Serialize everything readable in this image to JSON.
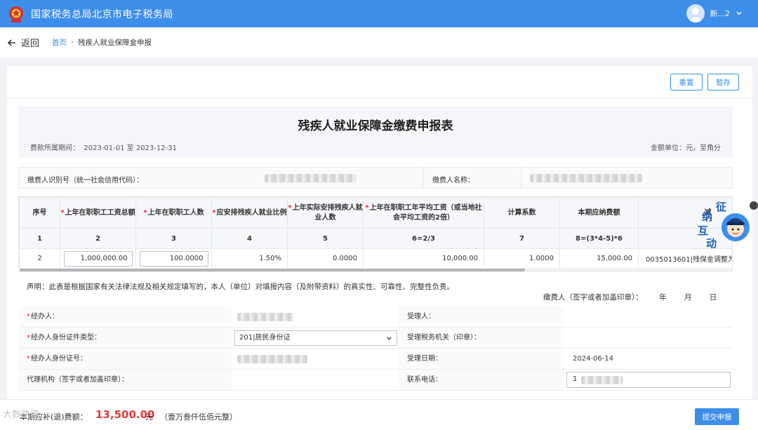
{
  "header": {
    "site_title": "国家税务总局北京市电子税务局",
    "user_name": "新...2"
  },
  "nav": {
    "back_label": "返回",
    "breadcrumb_home": "首页",
    "breadcrumb_sep": "›",
    "breadcrumb_current": "残疾人就业保障金申报"
  },
  "toolbar": {
    "reset_label": "重置",
    "save_label": "暂存"
  },
  "form": {
    "title": "残疾人就业保障金缴费申报表",
    "period_label": "费款所属期间：",
    "period_value": "2023-01-01 至 2023-12-31",
    "unit_label": "金额单位：元，至角分",
    "payer_id_label": "缴费人识别号（统一社会信用代码）：",
    "payer_name_label": "缴费人名称："
  },
  "table": {
    "required_mark": "*",
    "columns": [
      {
        "label": "序号",
        "required": false
      },
      {
        "label": "上年在职职工工资总额",
        "required": true
      },
      {
        "label": "上年在职职工人数",
        "required": true
      },
      {
        "label": "应安排残疾人就业比例",
        "required": true
      },
      {
        "label": "上年实际安排残疾人就业人数",
        "required": true
      },
      {
        "label": "上年在职职工年平均工资（或当地社会平均工资的2倍）",
        "required": true
      },
      {
        "label": "计算系数",
        "required": false
      },
      {
        "label": "本期应纳费额",
        "required": false
      },
      {
        "label": "减",
        "required": false
      }
    ],
    "index_row": [
      "1",
      "2",
      "3",
      "4",
      "5",
      "6=2/3",
      "7",
      "8=(3*4-5)*6",
      ""
    ],
    "data_row": [
      "2",
      "1,000,000.00",
      "100.0000",
      "1.50%",
      "0.0000",
      "10,000.00",
      "1.0000",
      "15,000.00",
      "0035013601|残保金调整为"
    ]
  },
  "declaration": {
    "text": "声明：此表是根据国家有关法律法规及相关规定填写的，本人（单位）对填报内容（及附带资料）的真实性、可靠性、完整性负责。",
    "sign_label": "缴费人（签字或者加盖印章）：",
    "year": "年",
    "month": "月",
    "day": "日"
  },
  "info": {
    "required_mark": "*",
    "agent_label": "经办人：",
    "agent_id_type_label": "经办人身份证件类型：",
    "agent_id_type_value": "201|居民身份证",
    "agent_id_label": "经办人身份证号：",
    "agency_label": "代理机构（签字或者加盖印章）：",
    "receiver_label": "受理人：",
    "tax_office_label": "受理税务机关（印章）：",
    "accept_date_label": "受理日期：",
    "accept_date_value": "2024-06-14",
    "phone_label": "联系电话：",
    "phone_value": "1"
  },
  "footer": {
    "amount_label": "本期应补(退)费额：",
    "amount_value": "13,500.00",
    "amount_unit": "元",
    "amount_cn": "（壹万叁仟伍佰元整）",
    "submit_label": "提交申报"
  },
  "watermark": "大数跨境",
  "float_chars": [
    "征",
    "纳",
    "互",
    "动"
  ],
  "colors": {
    "primary": "#3d8ee8",
    "amount": "#e4393c",
    "required": "#ee2233"
  }
}
